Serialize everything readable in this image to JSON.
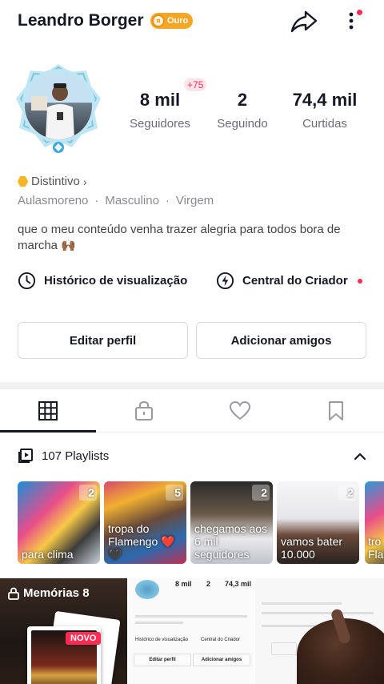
{
  "header": {
    "username": "Leandro Borger",
    "tier": "Ouro"
  },
  "stats": {
    "followers": {
      "value": "8 mil",
      "label": "Seguidores",
      "new": "+75"
    },
    "following": {
      "value": "2",
      "label": "Seguindo"
    },
    "likes": {
      "value": "74,4 mil",
      "label": "Curtidas"
    }
  },
  "profile": {
    "badge_label": "Distintivo",
    "tags": [
      "Aulasmoreno",
      "·",
      "Masculino",
      "·",
      "Virgem"
    ],
    "bio": "que o meu conteúdo venha trazer alegria para todos bora de marcha 🙌🏾"
  },
  "quick_links": {
    "history": "Histórico de visualização",
    "creator": "Central do Criador"
  },
  "buttons": {
    "edit": "Editar perfil",
    "add_friends": "Adicionar amigos"
  },
  "playlists": {
    "label": "107 Playlists",
    "items": [
      {
        "title": "para clima",
        "count": "2"
      },
      {
        "title": "tropa do Flamengo ❤️🖤",
        "count": "5"
      },
      {
        "title": "chegamos aos 6 mil seguidores",
        "count": "2"
      },
      {
        "title": "vamos bater 10.000",
        "count": "2"
      },
      {
        "title": "tro Fla",
        "count": ""
      }
    ]
  },
  "grid": {
    "memories_label": "Memórias 8",
    "new_badge": "NOVO",
    "mini_profile": {
      "followers": "8 mil",
      "following": "2",
      "likes": "74,3 mil",
      "edit": "Editar perfil",
      "add": "Adicionar amigos",
      "history": "Histórico de visualização",
      "creator": "Central do Criador"
    }
  },
  "colors": {
    "accent": "#fe2c55",
    "gold": "#f5a623",
    "text": "#161823",
    "muted": "#8a8b91"
  },
  "icons": [
    "share-icon",
    "more-vertical-icon",
    "clock-icon",
    "lightning-icon",
    "grid-icon",
    "lock-icon",
    "heart-icon",
    "bookmark-icon",
    "playlist-icon",
    "chevron-up-icon"
  ]
}
